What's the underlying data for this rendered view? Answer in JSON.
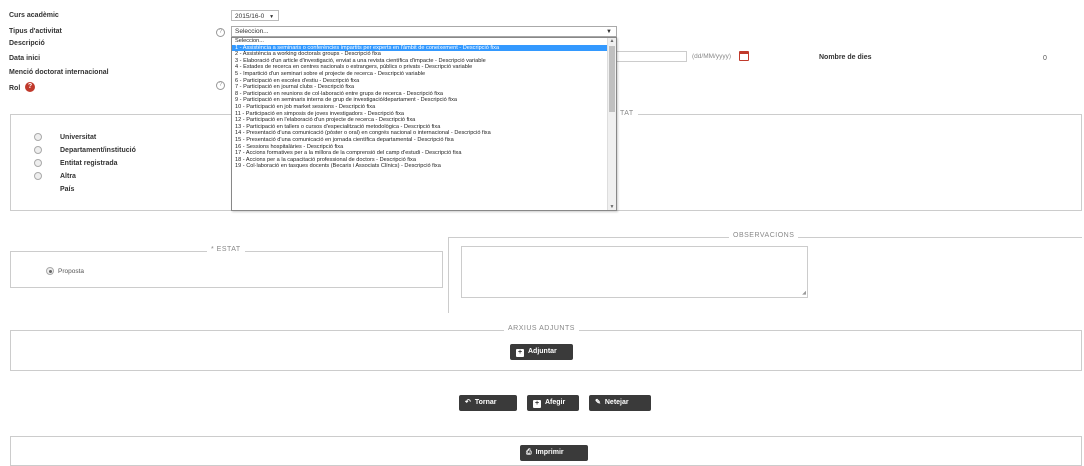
{
  "form": {
    "curs_label": "Curs acadèmic",
    "curs_value": "2015/16-0",
    "tipus_label": "Tipus d'activitat",
    "tipus_value": "Seleccion...",
    "descripcio_label": "Descripció",
    "data_inici_label": "Data inici",
    "date_format": "(dd/MM/yyyy)",
    "nombre_dies_label": "Nombre de dies",
    "nombre_dies_value": "0",
    "mencio_label": "Menció doctorat internacional",
    "rol_label": "Rol",
    "entitat_legend_partial": "TAT"
  },
  "dropdown": {
    "options": [
      "Seleccion...",
      "1 - Assistència a seminaris o conferències impartits per experts en l'àmbit de coneixement - Descripció fixa",
      "2 - Assistència a working doctorals groups - Descripció fixa",
      "3 - Elaboració d'un article d'investigació, enviat a una revista científica d'impacte - Descripció variable",
      "4 - Estades de recerca en centres nacionals o estrangers, públics o privats - Descripció variable",
      "5 - Impartició d'un seminari sobre el projecte de recerca - Descripció variable",
      "6 - Participació en escoles d'estiu - Descripció fixa",
      "7 - Participació en journal clubs - Descripció fixa",
      "8 - Participació en reunions de col·laboració entre grups de recerca - Descripció fixa",
      "9 - Participació en seminaris interns de grup de investigació/departament - Descripció fixa",
      "10 - Participació en job market sessions - Descripció fixa",
      "11 - Participació en simposis de joves investigadors - Descripció fixa",
      "12 - Participació en l'elaboració d'un projecte de recerca - Descripció fixa",
      "13 - Participació en tallers o cursos d'especialització metodològica - Descripció fixa",
      "14 - Presentació d'una comunicació (pòster o oral) en congrés nacional o internacional - Descripció fixa",
      "15 - Presentació d'una comunicació en jornada científica departamental - Descripció fixa",
      "16 - Sessions hospitalàries - Descripció fixa",
      "17 - Accions formatives per a la millora de la comprensió del camp d'estudi - Descripció fixa",
      "18 - Accions per a la capacitació professional de doctors - Descripció fixa",
      "19 - Col·laboració en tasques docents (Becaris i Associats Clínics) - Descripció fixa"
    ],
    "selected_index": 1
  },
  "entitat": {
    "options": [
      "Universitat",
      "Departament/institució",
      "Entitat registrada",
      "Altra"
    ],
    "pais_label": "País"
  },
  "estat": {
    "legend": "* ESTAT",
    "option": "Proposta"
  },
  "observacions": {
    "legend": "OBSERVACIONS"
  },
  "arxius": {
    "legend": "ARXIUS ADJUNTS",
    "adjuntar": "Adjuntar"
  },
  "actions": {
    "tornar": "Tornar",
    "afegir": "Afegir",
    "netejar": "Netejar",
    "imprimir": "Imprimir"
  },
  "colors": {
    "selected_option": "#3399ff",
    "button_bg": "#3a3a3a",
    "rol_badge": "#c0392b",
    "calendar_icon": "#c0392b"
  }
}
